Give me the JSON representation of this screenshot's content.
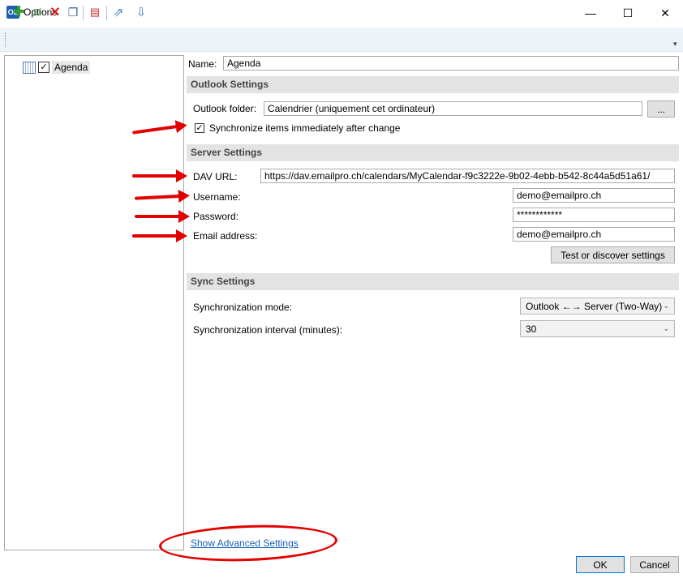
{
  "window": {
    "title": "Options",
    "app_icon_text": "OL",
    "minimize": "—",
    "maximize": "☐",
    "close": "✕"
  },
  "toolbar": {
    "icons": [
      "add-icon",
      "add-multiple-icon",
      "delete-icon",
      "copy-icon",
      "clear-icon",
      "export-icon",
      "import-icon"
    ],
    "overflow": "▾"
  },
  "tree": {
    "items": [
      {
        "label": "Agenda",
        "checked": true
      }
    ]
  },
  "name": {
    "label": "Name:",
    "value": "Agenda"
  },
  "outlook": {
    "header": "Outlook Settings",
    "folder_label": "Outlook folder:",
    "folder_value": "Calendrier (uniquement cet ordinateur)",
    "browse_button": "...",
    "sync_immediately_label": "Synchronize items immediately after change",
    "sync_immediately_checked": true,
    "check_mark": "✓"
  },
  "server": {
    "header": "Server Settings",
    "dav_url_label": "DAV URL:",
    "dav_url_value": "https://dav.emailpro.ch/calendars/MyCalendar-f9c3222e-9b02-4ebb-b542-8c44a5d51a61/",
    "username_label": "Username:",
    "username_value": "demo@emailpro.ch",
    "password_label": "Password:",
    "password_value": "************",
    "email_label": "Email address:",
    "email_value": "demo@emailpro.ch",
    "test_button": "Test or discover settings"
  },
  "sync": {
    "header": "Sync Settings",
    "mode_label": "Synchronization mode:",
    "mode_value": "Outlook ←→ Server (Two-Way)",
    "interval_label": "Synchronization interval (minutes):",
    "interval_value": "30",
    "chevron": "⌄"
  },
  "footer": {
    "advanced_link": "Show Advanced Settings",
    "ok_button": "OK",
    "cancel_button": "Cancel"
  },
  "colors": {
    "annotation": "#e10000",
    "link": "#1a5fb4",
    "section_bg": "#e3e3e3",
    "toolbar_bg": "#eef3fa"
  }
}
